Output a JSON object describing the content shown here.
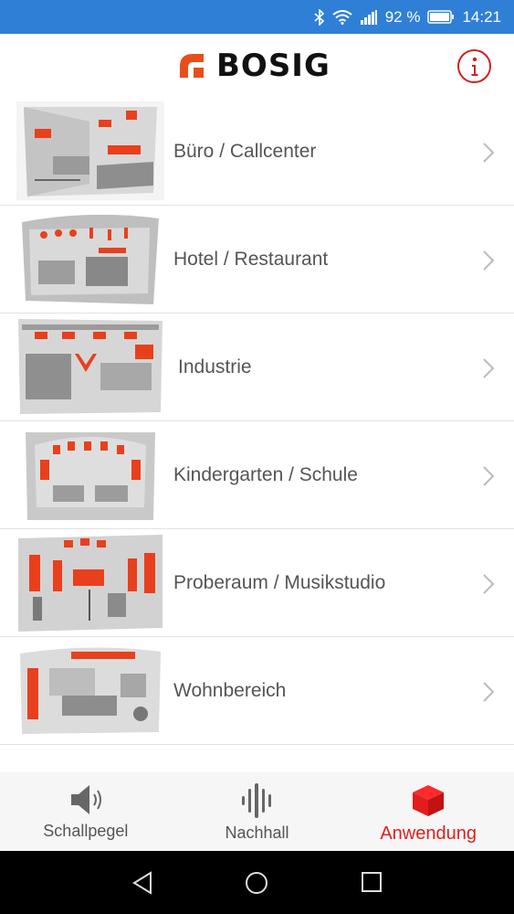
{
  "status": {
    "battery_percent": "92 %",
    "time": "14:21",
    "icons": [
      "bluetooth-icon",
      "wifi-icon",
      "signal-icon",
      "battery-icon"
    ]
  },
  "header": {
    "logo_text": "BOSIG",
    "brand_color": "#e84e1b",
    "info_icon": "info-icon",
    "accent_color": "#d42020"
  },
  "list": [
    {
      "label": "Büro / Callcenter"
    },
    {
      "label": "Hotel / Restaurant"
    },
    {
      "label": "Industrie"
    },
    {
      "label": "Kindergarten / Schule"
    },
    {
      "label": "Proberaum / Musikstudio"
    },
    {
      "label": "Wohnbereich"
    }
  ],
  "tabs": [
    {
      "label": "Schallpegel",
      "icon": "speaker-icon",
      "active": false
    },
    {
      "label": "Nachhall",
      "icon": "sound-wave-icon",
      "active": false
    },
    {
      "label": "Anwendung",
      "icon": "cube-icon",
      "active": true
    }
  ],
  "system_nav": [
    "back-icon",
    "home-icon",
    "recents-icon"
  ]
}
